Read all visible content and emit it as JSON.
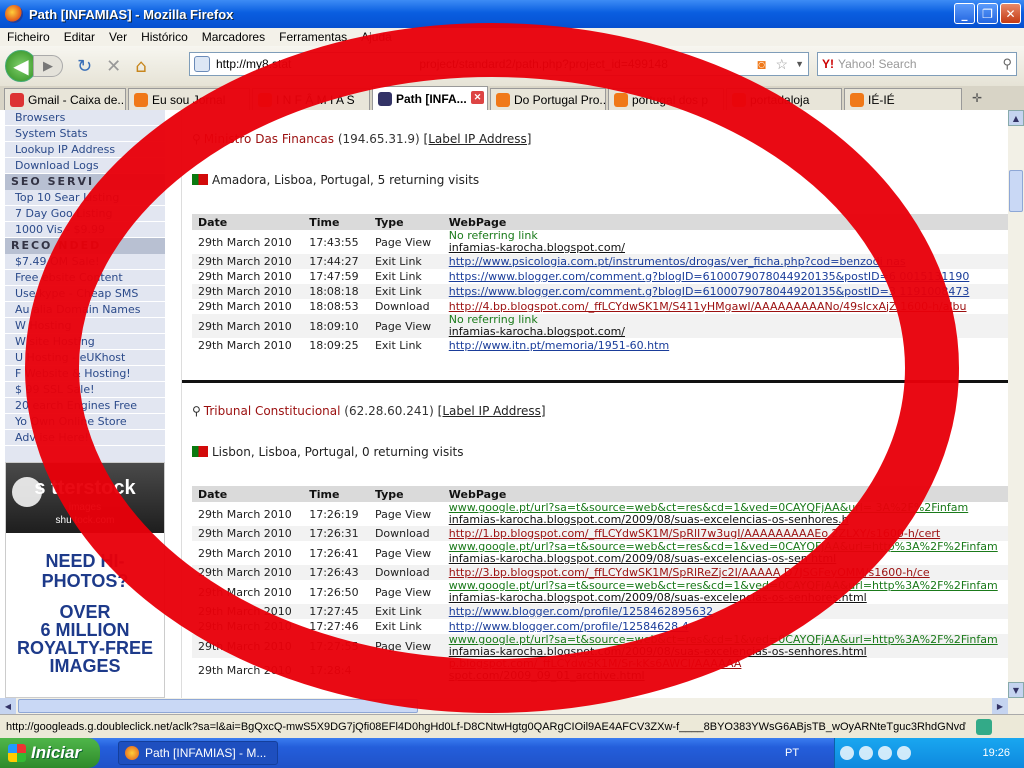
{
  "window": {
    "title": "Path [INFAMIAS] - Mozilla Firefox",
    "min": "_",
    "max": "❐",
    "close": "✕"
  },
  "menu": [
    "Ficheiro",
    "Editar",
    "Ver",
    "Histórico",
    "Marcadores",
    "Ferramentas",
    "Ajuda"
  ],
  "nav": {
    "url": "http://my8.stat",
    "url_tail": "project/standard2/path.php?project_id=499148",
    "search_placeholder": "Yahoo! Search",
    "search_brand": "Y!"
  },
  "tabs": [
    {
      "label": "Gmail - Caixa de...",
      "color": "#d33"
    },
    {
      "label": "Eu sou Jornal",
      "color": "#f07818"
    },
    {
      "label": "I N F Â M I A S",
      "color": "#f07818"
    },
    {
      "label": "Path [INFA...",
      "color": "#336",
      "active": true
    },
    {
      "label": "Do Portugal Pro...",
      "color": "#f07818"
    },
    {
      "label": "portugal dos p",
      "color": "#f07818"
    },
    {
      "label": "portadaloja",
      "color": "#f07818"
    },
    {
      "label": "IÉ-IÉ",
      "color": "#f07818"
    }
  ],
  "sidebar": {
    "top_links": [
      "Browsers",
      "System Stats",
      "Lookup IP Address",
      "Download Logs"
    ],
    "seo_head": "SEO SERVI",
    "seo_links": [
      "Top 10 Sear  Listing",
      "7 Day Goo   Listing",
      "1000 Vis   - $9.99"
    ],
    "rec_head": "RECO   NDED",
    "rec_links": [
      "$7.49   OM Sale!",
      "Free  ebsite Content",
      "Use  kype - Cheap SMS",
      "Au   alia Domain Names",
      "W   Hosting",
      "W   site Hosting",
      "U   Hosting - eUKhost",
      "F   Website & Hosting!",
      "$   99 SSL Sale!",
      "20   earch Engines Free",
      "Yo   Own Online Store",
      "Adv   ise Here!"
    ],
    "ad": {
      "brand": "s   tterstock",
      "brand_sub": "images",
      "site": "shu    tock.com",
      "line1": "NEED HI-   ",
      "line2": "PHOTOS?",
      "line3": "OVER",
      "line4": "6 MILLION",
      "line5": "ROYALTY-FREE",
      "line6": "IMAGES"
    }
  },
  "visitors": [
    {
      "name": "Ministro Das Financas",
      "ip": "(194.65.31.9)",
      "label_link": "[Label IP Address]",
      "location": "Amadora, Lisboa, Portugal, 5 returning visits",
      "columns": [
        "Date",
        "Time",
        "Type",
        "WebPage"
      ],
      "rows": [
        {
          "date": "29th March 2010",
          "time": "17:43:55",
          "type": "Page View",
          "ref": "No referring link",
          "page": "infamias-karocha.blogspot.com/",
          "pcls": "blk"
        },
        {
          "date": "29th March 2010",
          "time": "17:44:27",
          "type": "Exit Link",
          "page": "http://www.psicologia.com.pt/instrumentos/drogas/ver_ficha.php?cod=benzodi   nas",
          "pcls": ""
        },
        {
          "date": "29th March 2010",
          "time": "17:47:59",
          "type": "Exit Link",
          "page": "https://www.blogger.com/comment.g?blogID=6100079078044920135&postID=6    0015131190",
          "pcls": ""
        },
        {
          "date": "29th March 2010",
          "time": "18:08:18",
          "type": "Exit Link",
          "page": "https://www.blogger.com/comment.g?blogID=6100079078044920135&postID=3   1191008473",
          "pcls": ""
        },
        {
          "date": "29th March 2010",
          "time": "18:08:53",
          "type": "Download",
          "page": "http://4.bp.blogspot.com/_ffLCYdwSK1M/S411yHMgawI/AAAAAAAAANo/49slcxAjZ   1600-h/albu",
          "pcls": "red"
        },
        {
          "date": "29th March 2010",
          "time": "18:09:10",
          "type": "Page View",
          "ref": "No referring link",
          "page": "infamias-karocha.blogspot.com/",
          "pcls": "blk"
        },
        {
          "date": "29th March 2010",
          "time": "18:09:25",
          "type": "Exit Link",
          "page": "http://www.itn.pt/memoria/1951-60.htm",
          "pcls": ""
        }
      ]
    },
    {
      "name": "Tribunal Constitucional",
      "ip": "(62.28.60.241)",
      "label_link": "[Label IP Address]",
      "location": "Lisbon, Lisboa, Portugal, 0 returning visits",
      "columns": [
        "Date",
        "Time",
        "Type",
        "WebPage"
      ],
      "rows": [
        {
          "date": "29th March 2010",
          "time": "17:26:19",
          "type": "Page View",
          "ref": "www.google.pt/url?sa=t&source=web&ct=res&cd=1&ved=0CAYQFjAA&url=   3A%2F%2Finfam",
          "page": "infamias-karocha.blogspot.com/2009/08/suas-excelencias-os-senhores.h",
          "pcls": "blk",
          "rcls": "green"
        },
        {
          "date": "29th March 2010",
          "time": "17:26:31",
          "type": "Download",
          "page": "http://1.bp.blogspot.com/_ffLCYdwSK1M/SpRlI7w3ugI/AAAAAAAAAEo   2ZLXY/s1600-h/cert",
          "pcls": "red"
        },
        {
          "date": "29th March 2010",
          "time": "17:26:41",
          "type": "Page View",
          "ref": "www.google.pt/url?sa=t&source=web&ct=res&cd=1&ved=0CAYQFjAA&url=http%3A%2F%2Finfam",
          "page": "infamias-karocha.blogspot.com/2009/08/suas-excelencias-os-sen   html",
          "pcls": "blk",
          "rcls": "green"
        },
        {
          "date": "29th March 2010",
          "time": "17:26:43",
          "type": "Download",
          "page": "http://3.bp.blogspot.com/_ffLCYdwSK1M/SpRlReZjc2I/AAAAA   D7JSGFeyOMM/s1600-h/ce",
          "pcls": "red"
        },
        {
          "date": "29th March 2010",
          "time": "17:26:50",
          "type": "Page View",
          "ref": "www.google.pt/url?sa=t&source=web&ct=res&cd=1&ved=0CAYQFjAA&url=http%3A%2F%2Finfam",
          "page": "infamias-karocha.blogspot.com/2009/08/suas-excelencias-os-senhores.html",
          "pcls": "blk",
          "rcls": "green"
        },
        {
          "date": "29th March 2010",
          "time": "17:27:45",
          "type": "Exit Link",
          "page": "http://www.blogger.com/profile/1258462895632",
          "pcls": ""
        },
        {
          "date": "29th March 2010",
          "time": "17:27:46",
          "type": "Exit Link",
          "page": "http://www.blogger.com/profile/12584628   4",
          "pcls": ""
        },
        {
          "date": "29th March 2010",
          "time": "17:27:55",
          "type": "Page View",
          "ref": "www.google.pt/url?sa=t&source=web&ct=res&cd=1&ved=0CAYQFjAA&url=http%3A%2F%2Finfam",
          "page": "infamias-karocha.blogspot.com/2009/08/suas-excelencias-os-senhores.html",
          "pcls": "blk",
          "rcls": "green"
        },
        {
          "date": "29th March 2010",
          "time": "17:28:4",
          "type": "",
          "ref": "   p.blogspot.com/_ffLCYdwSK1M/Sr-kKs6AWCI/AAAAAA",
          "page": "   spot.com/2009_09_01_archive.html",
          "pcls": "blk",
          "rcls": "red"
        }
      ]
    }
  ],
  "status": {
    "text": "http://googleads.g.doubleclick.net/aclk?sa=l&ai=BgQxcQ-mwS5X9DG7jQfi08EFl4D0hgHd0Lf-D8CNtwHgtg0QARgCIOil9AE4AFCV3ZXw-f____8BYO383YWsG6ABjsTB_wOyARNteTguc3RhdGNvdW5..."
  },
  "taskbar": {
    "start": "Iniciar",
    "item": "Path [INFAMIAS] - M...",
    "lang": "PT",
    "clock": "19:26"
  }
}
